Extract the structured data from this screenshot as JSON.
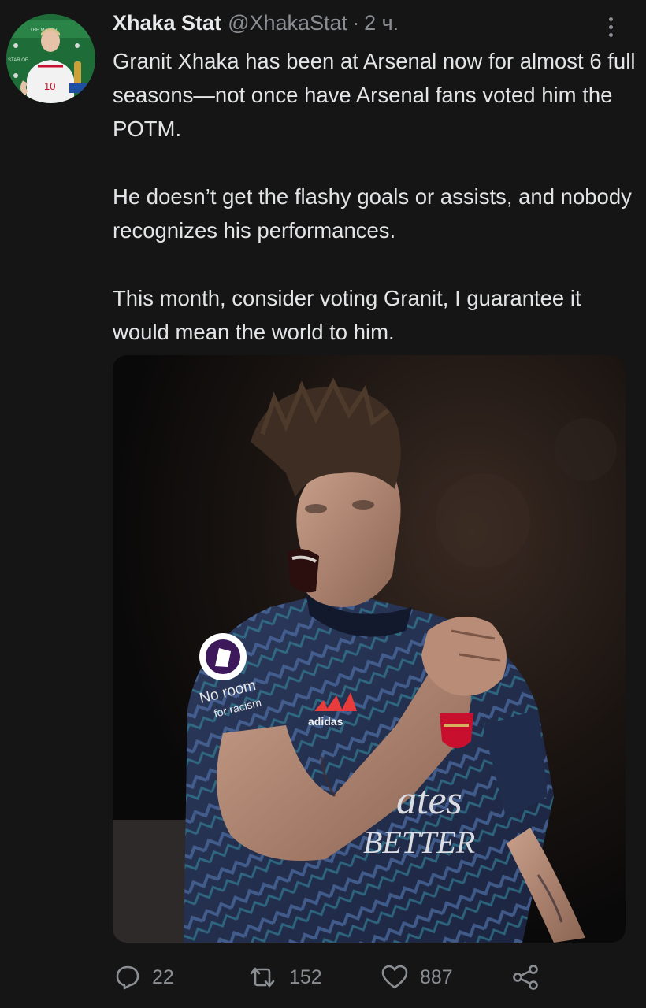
{
  "author": {
    "display_name": "Xhaka Stat",
    "handle": "@XhakaStat",
    "separator": "·",
    "timestamp": "2 ч."
  },
  "tweet": {
    "paragraphs": [
      "Granit Xhaka has been at Arsenal now for almost 6 full seasons—not once have Arsenal fans voted him the POTM.",
      "He doesn’t get the flashy goals or assists, and nobody recognizes his performances.",
      "This month, consider voting Granit, I guarantee it would mean the world to him."
    ]
  },
  "media": {
    "jersey_texts": {
      "sponsor": "adidas",
      "no_room": "No room",
      "racism": "for racism",
      "chest_1": "ates",
      "chest_2": "BETTER"
    }
  },
  "avatar": {
    "board_text_1": "THE MATCH",
    "board_text_2": "STAR OF",
    "shirt_number": "10"
  },
  "actions": {
    "reply_count": "22",
    "retweet_count": "152",
    "like_count": "887"
  },
  "icons": {
    "reply": "reply-icon",
    "retweet": "retweet-icon",
    "like": "heart-icon",
    "share": "share-icon",
    "more": "more-vertical-icon"
  },
  "colors": {
    "background": "#151515",
    "text": "#e7e9ea",
    "secondary_text": "#8b8f94"
  }
}
